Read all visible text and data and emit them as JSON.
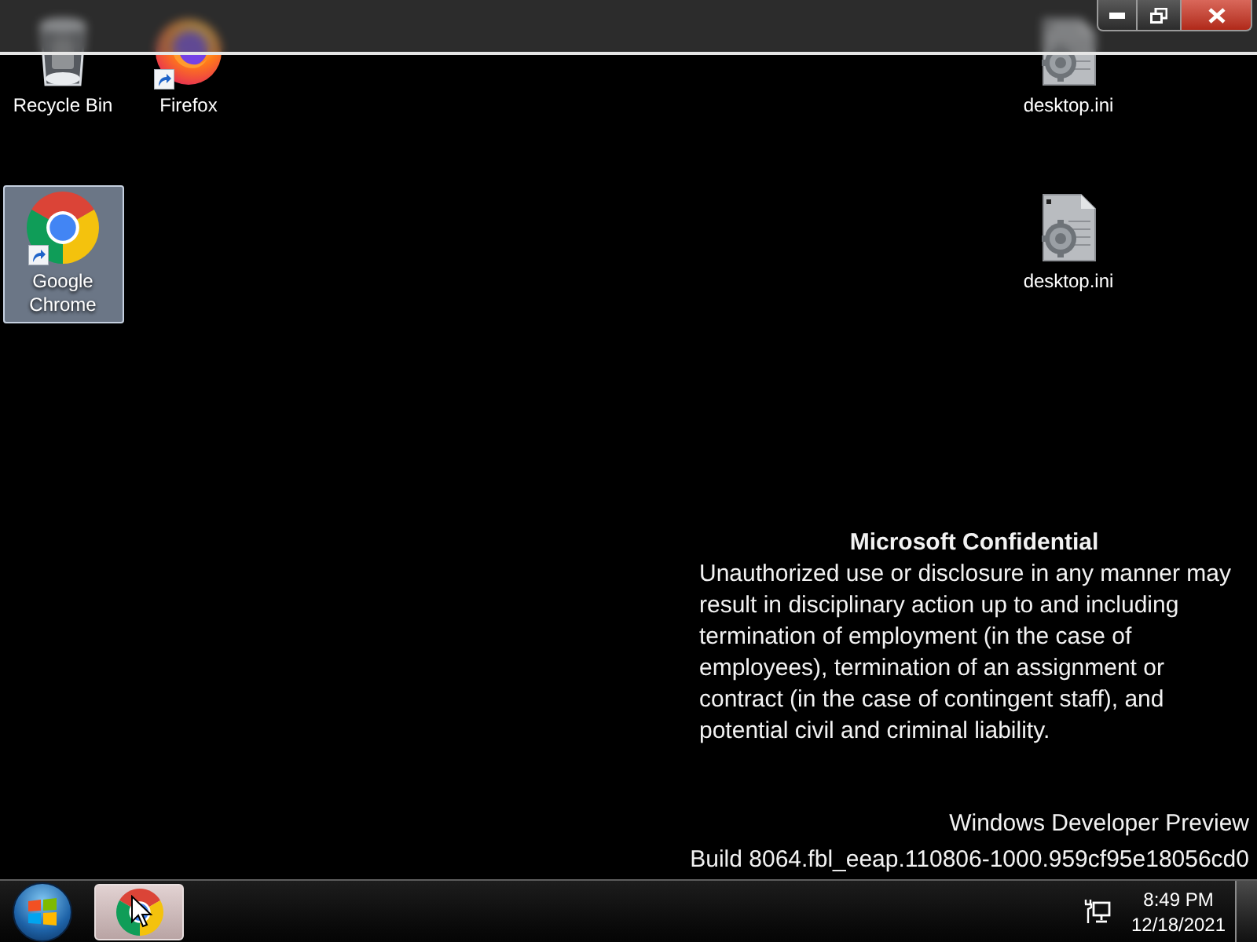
{
  "desktop_icons": [
    {
      "kind": "recycle_bin",
      "label": "Recycle Bin",
      "shortcut": false,
      "selected": false
    },
    {
      "kind": "firefox",
      "label": "Firefox",
      "shortcut": true,
      "selected": false
    },
    {
      "kind": "ini_file",
      "label": "desktop.ini",
      "shortcut": false,
      "selected": false
    },
    {
      "kind": "chrome",
      "label": "Google Chrome",
      "shortcut": true,
      "selected": true
    },
    {
      "kind": "ini_file",
      "label": "desktop.ini",
      "shortcut": false,
      "selected": false
    }
  ],
  "confidential_notice": {
    "title": "Microsoft Confidential",
    "body": "Unauthorized use or disclosure in any manner may result in disciplinary action up to and including termination of employment (in the case of employees), termination of an assignment or contract (in the case of contingent staff), and potential civil and criminal liability."
  },
  "build_info": {
    "edition": "Windows Developer Preview",
    "build": "Build 8064.fbl_eeap.110806-1000.959cf95e18056cd0"
  },
  "taskbar": {
    "buttons": [
      {
        "kind": "chrome",
        "selected": true
      }
    ],
    "clock": {
      "time": "8:49 PM",
      "date": "12/18/2021"
    }
  }
}
